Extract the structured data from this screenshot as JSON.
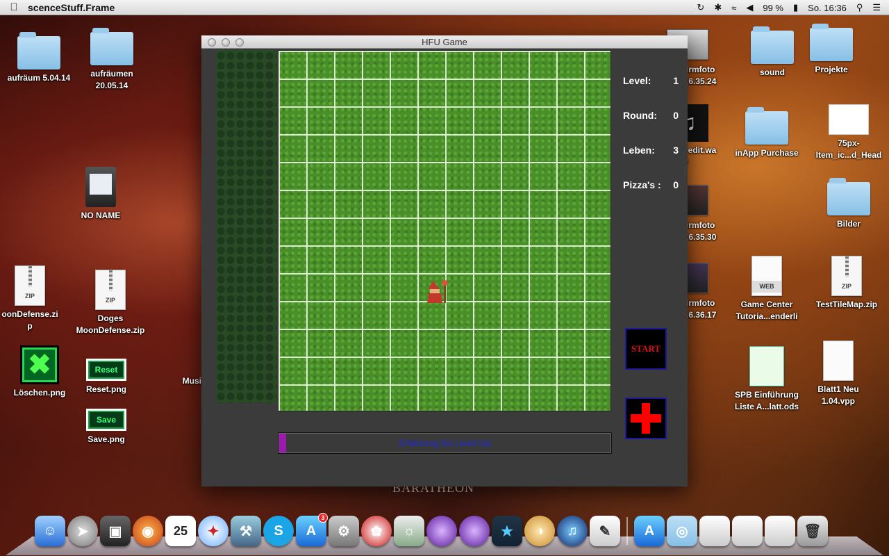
{
  "menubar": {
    "apple": "",
    "app_name": "scenceStuff.Frame",
    "battery": "99 %",
    "clock": "So. 16:36"
  },
  "desktop": {
    "aufraeum": "aufräum 5.04.14",
    "aufraeumen": "aufräumen\n20.05.14",
    "no_name": "NO NAME",
    "moon_zip": "oonDefense.zi\np",
    "doges_zip": "Doges\nMoonDefense.zip",
    "loeschen": "Löschen.png",
    "reset": "Reset.png",
    "reset_inner": "Reset",
    "save": "Save.png",
    "save_inner": "Save",
    "musi": "Musi",
    "irmfoto1": "irmfoto\n.6.35.24",
    "edit_wav": "_edit.wa\nv",
    "irmfoto2": "irmfoto\n.6.35.30",
    "irmfoto3": "irmfoto\n.6.36.17",
    "sound": "sound",
    "projekte": "Projekte",
    "inapp": "inApp Purchase",
    "item_head": "75px-\nItem_ic...d_Head",
    "bilder": "Bilder",
    "gamecenter": "Game Center\nTutoria...enderli",
    "testtilemap": "TestTileMap.zip",
    "spb": "SPB Einführung\nListe A...latt.ods",
    "blatt1": "Blatt1 Neu\n1.04.vpp",
    "zip_tag": "ZIP",
    "web_tag": "WEB"
  },
  "window": {
    "title": "HFU Game"
  },
  "stats": {
    "level_label": "Level:",
    "level_value": "1",
    "round_label": "Round:",
    "round_value": "0",
    "leben_label": "Leben:",
    "leben_value": "3",
    "pizza_label": "Pizza's :",
    "pizza_value": "0"
  },
  "buttons": {
    "start": "START"
  },
  "xp": {
    "label": "Erfahrung bis Level Up",
    "progress": 0.02,
    "fill_color": "#9a1ab0"
  },
  "wallpaper_text": "BARATHEON",
  "dock": {
    "calendar_day": "25",
    "appstore_badge": "3"
  }
}
